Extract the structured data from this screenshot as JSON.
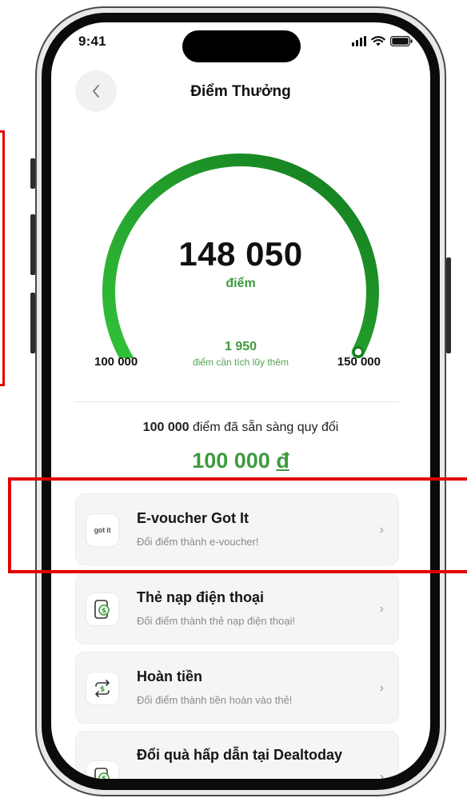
{
  "status_bar": {
    "time": "9:41"
  },
  "header": {
    "title": "Điểm Thưởng"
  },
  "gauge": {
    "points": "148 050",
    "points_unit": "điểm",
    "remaining_points": "1 950",
    "remaining_label": "điểm cần tích lũy thêm",
    "min_label": "100 000",
    "max_label": "150 000",
    "progress_fraction": 0.961,
    "track_color": "#efefef",
    "progress_color_start": "#33c43a",
    "progress_color_end": "#137a1e"
  },
  "redeem": {
    "points_ready": "100 000",
    "points_ready_suffix": "điểm đã sẵn sàng quy đổi",
    "amount": "100 000",
    "currency": "đ"
  },
  "options": [
    {
      "title": "E-voucher Got It",
      "subtitle": "Đổi điểm thành e-voucher!",
      "icon": "got-it-logo-icon",
      "logo_text": "got it"
    },
    {
      "title": "Thẻ nạp điện thoại",
      "subtitle": "Đổi điểm thành thẻ nạp điện thoại!",
      "icon": "phone-topup-icon"
    },
    {
      "title": "Hoàn tiền",
      "subtitle": "Đổi điểm thành tiền hoàn vào thẻ!",
      "icon": "cashback-icon"
    },
    {
      "title": "Đổi quà hấp dẫn tại Dealtoday",
      "subtitle": "",
      "icon": "dealtoday-icon"
    }
  ],
  "colors": {
    "accent_green": "#3f9a3e",
    "highlight_red": "#e00000"
  }
}
